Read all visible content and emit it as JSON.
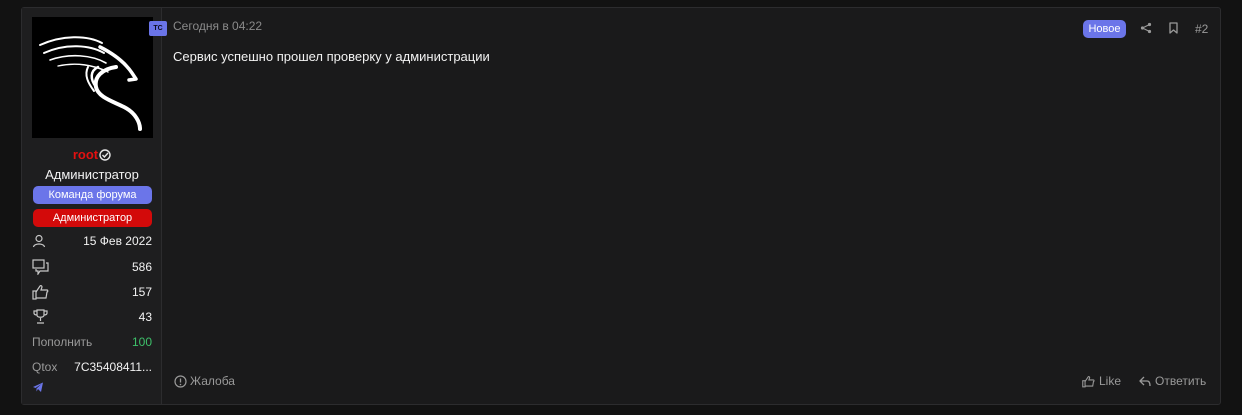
{
  "user": {
    "tc_badge": "ТС",
    "username": "root",
    "title": "Администратор",
    "banners": [
      "Команда форума",
      "Администратор"
    ],
    "stats": {
      "joined": "15 Фев 2022",
      "messages": "586",
      "reactions": "157",
      "trophies": "43"
    },
    "custom_fields": [
      {
        "label": "Пополнить",
        "value": "100"
      },
      {
        "label": "Qtox",
        "value": "7C35408411..."
      }
    ]
  },
  "post": {
    "date": "Сегодня в 04:22",
    "new_label": "Новое",
    "number": "#2",
    "text": "Сервис успешно прошел проверку у администрации",
    "complaint_label": "Жалоба",
    "like_label": "Like",
    "reply_label": "Ответить"
  },
  "colors": {
    "accent": "#6b75e9",
    "admin_red": "#d30a0a",
    "username_red": "#e31010",
    "green": "#3ec06a",
    "background": "#121212",
    "card": "#1a1a1b"
  },
  "icons": [
    "user-icon",
    "messages-icon",
    "thumbs-up-icon",
    "trophy-icon",
    "telegram-icon",
    "share-icon",
    "bookmark-icon",
    "info-circle-icon",
    "reply-icon",
    "verified-check-icon",
    "dragon-logo-icon"
  ]
}
